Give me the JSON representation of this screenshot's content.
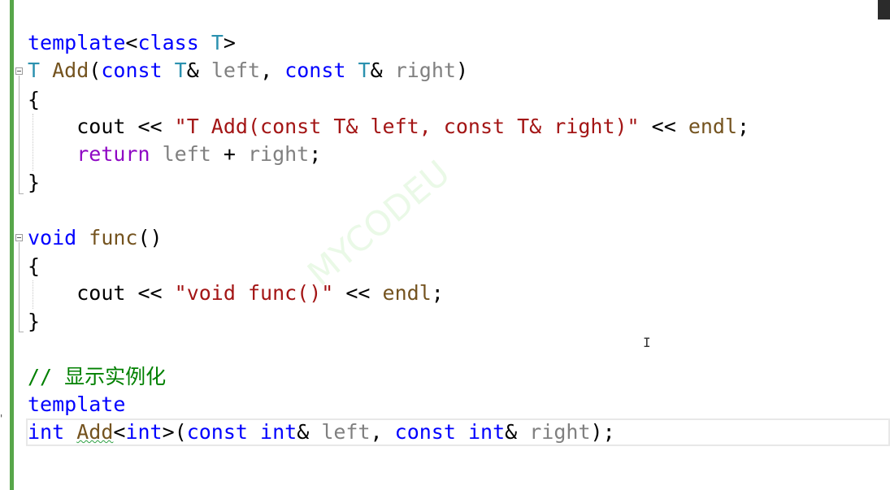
{
  "editor": {
    "lines": {
      "l1": {
        "kw": "template",
        "p1": "<",
        "kw2": "class",
        "sp": " ",
        "tp": "T",
        "p2": ">"
      },
      "l2": {
        "tp1": "T",
        "sp1": " ",
        "fn": "Add",
        "p1": "(",
        "kw1": "const",
        "sp2": " ",
        "tp2": "T",
        "amp1": "&",
        "sp3": " ",
        "pm1": "left",
        "c1": ", ",
        "kw2": "const",
        "sp4": " ",
        "tp3": "T",
        "amp2": "&",
        "sp5": " ",
        "pm2": "right",
        "p2": ")"
      },
      "l3": {
        "text": "{"
      },
      "l4": {
        "indent": "    ",
        "id": "cout",
        "op1": " << ",
        "str": "\"T Add(const T& left, const T& right)\"",
        "op2": " << ",
        "fn": "endl",
        "end": ";"
      },
      "l5": {
        "indent": "    ",
        "kw": "return",
        "sp": " ",
        "pm1": "left",
        "op": " + ",
        "pm2": "right",
        "end": ";"
      },
      "l6": {
        "text": "}"
      },
      "l7": {
        "kw": "void",
        "sp": " ",
        "fn": "func",
        "p": "()"
      },
      "l8": {
        "text": "{"
      },
      "l9": {
        "indent": "    ",
        "id": "cout",
        "op1": " << ",
        "str": "\"void func()\"",
        "op2": " << ",
        "fn": "endl",
        "end": ";"
      },
      "l10": {
        "text": "}"
      },
      "l11": {
        "comment": "// 显示实例化"
      },
      "l12": {
        "kw": "template"
      },
      "l13": {
        "kw1": "int",
        "sp1": " ",
        "fn": "Add",
        "p1": "<",
        "kw2": "int",
        "p2": ">(",
        "kw3": "const",
        "sp2": " ",
        "kw4": "int",
        "amp1": "&",
        "sp3": " ",
        "pm1": "left",
        "c1": ", ",
        "kw5": "const",
        "sp4": " ",
        "kw6": "int",
        "amp2": "&",
        "sp5": " ",
        "pm2": "right",
        "end": ");"
      }
    },
    "margin_mark": "'",
    "cursor_glyph": "I",
    "watermark": "MYCODEU"
  },
  "colors": {
    "keyword": "#0000ff",
    "control_keyword": "#8f08c4",
    "type": "#2b91af",
    "function": "#74531f",
    "parameter": "#808080",
    "string": "#a31515",
    "comment": "#008000",
    "change_bar": "#57a64a"
  }
}
